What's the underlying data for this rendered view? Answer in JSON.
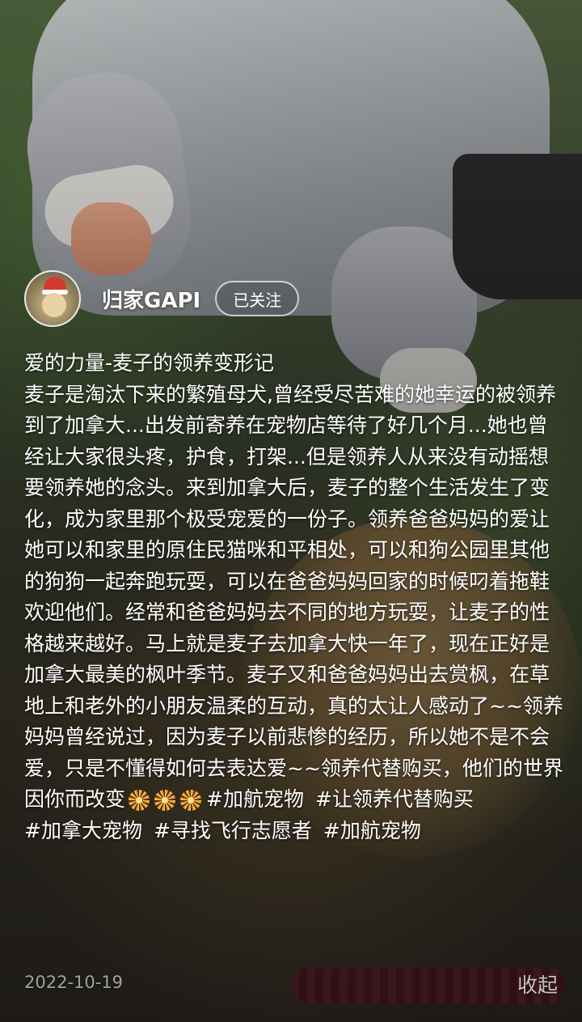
{
  "author": {
    "name": "归家GAPI",
    "follow_label": "已关注"
  },
  "post": {
    "title": "爱的力量-麦子的领养变形记",
    "body": "麦子是淘汰下来的繁殖母犬,曾经受尽苦难的她幸运的被领养到了加拿大...出发前寄养在宠物店等待了好几个月...她也曾经让大家很头疼，护食，打架...但是领养人从来没有动摇想要领养她的念头。来到加拿大后，麦子的整个生活发生了变化，成为家里那个极受宠爱的一份子。领养爸爸妈妈的爱让她可以和家里的原住民猫咪和平相处，可以和狗公园里其他的狗狗一起奔跑玩耍，可以在爸爸妈妈回家的时候叼着拖鞋欢迎他们。经常和爸爸妈妈去不同的地方玩耍，让麦子的性格越来越好。马上就是麦子去加拿大快一年了，现在正好是加拿大最美的枫叶季节。麦子又和爸爸妈妈出去赏枫，在草地上和老外的小朋友温柔的互动，真的太让人感动了~~领养妈妈曾经说过，因为麦子以前悲惨的经历，所以她不是不会爱，只是不懂得如何去表达爱~~领养代替购买，他们的世界因你而改变",
    "emoji_icons": [
      "firework-icon",
      "firework-icon",
      "firework-icon"
    ],
    "hashtags": [
      "#加航宠物",
      "#让领养代替购买",
      "#加拿大宠物",
      "#寻找飞行志愿者",
      "#加航宠物"
    ],
    "date": "2022-10-19",
    "collapse_label": "收起"
  }
}
